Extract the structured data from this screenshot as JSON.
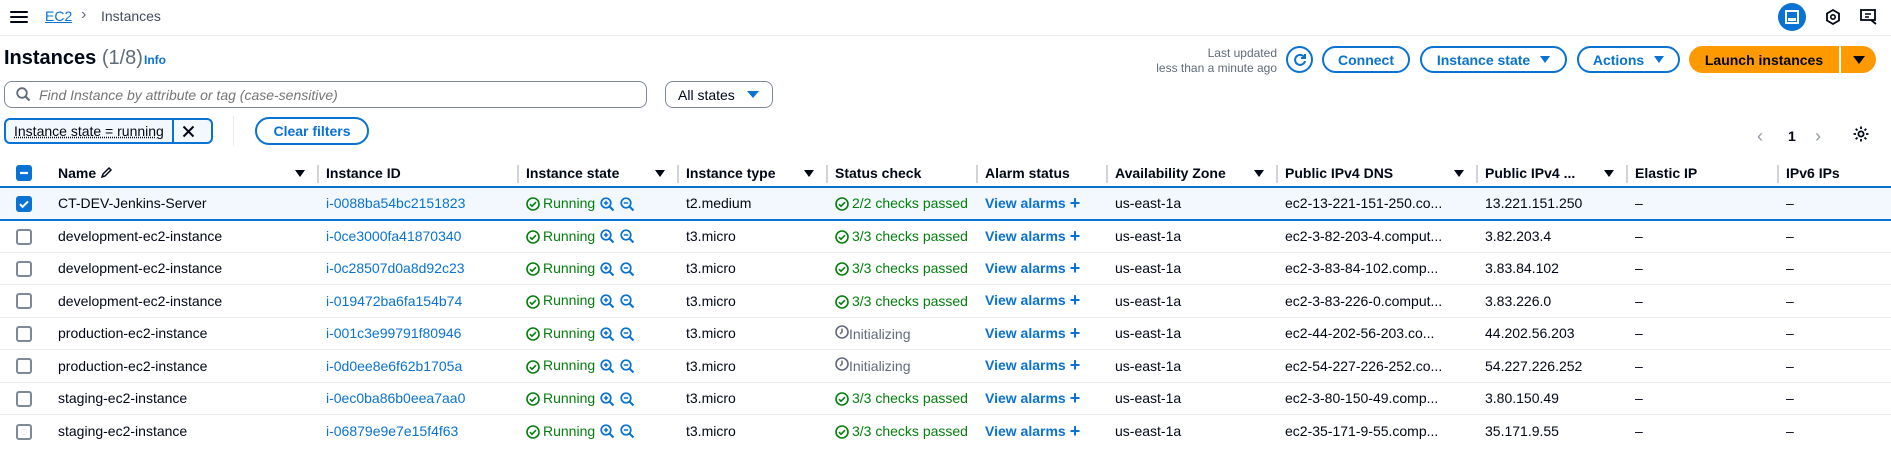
{
  "topbar": {
    "breadcrumb_root": "EC2",
    "breadcrumb_current": "Instances"
  },
  "header": {
    "title": "Instances",
    "count": "(1/8)",
    "info": "Info",
    "last_updated_line1": "Last updated",
    "last_updated_line2": "less than a minute ago",
    "connect": "Connect",
    "instance_state": "Instance state",
    "actions": "Actions",
    "launch": "Launch instances"
  },
  "filters": {
    "search_placeholder": "Find Instance by attribute or tag (case-sensitive)",
    "states_select": "All states",
    "token": "Instance state = running",
    "clear": "Clear filters"
  },
  "pagination": {
    "page": "1"
  },
  "columns": [
    "Name",
    "Instance ID",
    "Instance state",
    "Instance type",
    "Status check",
    "Alarm status",
    "Availability Zone",
    "Public IPv4 DNS",
    "Public IPv4 ...",
    "Elastic IP",
    "IPv6 IPs"
  ],
  "rows": [
    {
      "selected": true,
      "name": "CT-DEV-Jenkins-Server",
      "id": "i-0088ba54bc2151823",
      "state": "Running",
      "type": "t2.medium",
      "status": "2/2 checks passed",
      "status_ok": true,
      "alarm": "View alarms",
      "az": "us-east-1a",
      "dns": "ec2-13-221-151-250.co...",
      "ip": "13.221.151.250",
      "eip": "–",
      "ipv6": "–"
    },
    {
      "selected": false,
      "name": "development-ec2-instance",
      "id": "i-0ce3000fa41870340",
      "state": "Running",
      "type": "t3.micro",
      "status": "3/3 checks passed",
      "status_ok": true,
      "alarm": "View alarms",
      "az": "us-east-1a",
      "dns": "ec2-3-82-203-4.comput...",
      "ip": "3.82.203.4",
      "eip": "–",
      "ipv6": "–"
    },
    {
      "selected": false,
      "name": "development-ec2-instance",
      "id": "i-0c28507d0a8d92c23",
      "state": "Running",
      "type": "t3.micro",
      "status": "3/3 checks passed",
      "status_ok": true,
      "alarm": "View alarms",
      "az": "us-east-1a",
      "dns": "ec2-3-83-84-102.comp...",
      "ip": "3.83.84.102",
      "eip": "–",
      "ipv6": "–"
    },
    {
      "selected": false,
      "name": "development-ec2-instance",
      "id": "i-019472ba6fa154b74",
      "state": "Running",
      "type": "t3.micro",
      "status": "3/3 checks passed",
      "status_ok": true,
      "alarm": "View alarms",
      "az": "us-east-1a",
      "dns": "ec2-3-83-226-0.comput...",
      "ip": "3.83.226.0",
      "eip": "–",
      "ipv6": "–"
    },
    {
      "selected": false,
      "name": "production-ec2-instance",
      "id": "i-001c3e99791f80946",
      "state": "Running",
      "type": "t3.micro",
      "status": "Initializing",
      "status_ok": false,
      "alarm": "View alarms",
      "az": "us-east-1a",
      "dns": "ec2-44-202-56-203.co...",
      "ip": "44.202.56.203",
      "eip": "–",
      "ipv6": "–"
    },
    {
      "selected": false,
      "name": "production-ec2-instance",
      "id": "i-0d0ee8e6f62b1705a",
      "state": "Running",
      "type": "t3.micro",
      "status": "Initializing",
      "status_ok": false,
      "alarm": "View alarms",
      "az": "us-east-1a",
      "dns": "ec2-54-227-226-252.co...",
      "ip": "54.227.226.252",
      "eip": "–",
      "ipv6": "–"
    },
    {
      "selected": false,
      "name": "staging-ec2-instance",
      "id": "i-0ec0ba86b0eea7aa0",
      "state": "Running",
      "type": "t3.micro",
      "status": "3/3 checks passed",
      "status_ok": true,
      "alarm": "View alarms",
      "az": "us-east-1a",
      "dns": "ec2-3-80-150-49.comp...",
      "ip": "3.80.150.49",
      "eip": "–",
      "ipv6": "–"
    },
    {
      "selected": false,
      "name": "staging-ec2-instance",
      "id": "i-06879e9e7e15f4f63",
      "state": "Running",
      "type": "t3.micro",
      "status": "3/3 checks passed",
      "status_ok": true,
      "alarm": "View alarms",
      "az": "us-east-1a",
      "dns": "ec2-35-171-9-55.comp...",
      "ip": "35.171.9.55",
      "eip": "–",
      "ipv6": "–"
    }
  ],
  "colors": {
    "link": "#0972d3",
    "success": "#037f0c",
    "primary": "#ff9900"
  },
  "icons": [
    "menu-icon",
    "chevron-right-icon",
    "panel-icon",
    "settings-hex-icon",
    "feedback-icon",
    "refresh-icon",
    "search-icon",
    "close-icon",
    "chevron-left-icon",
    "gear-icon",
    "pencil-icon",
    "check-circle-icon",
    "clock-icon",
    "zoom-in-icon",
    "zoom-out-icon",
    "plus-icon"
  ]
}
